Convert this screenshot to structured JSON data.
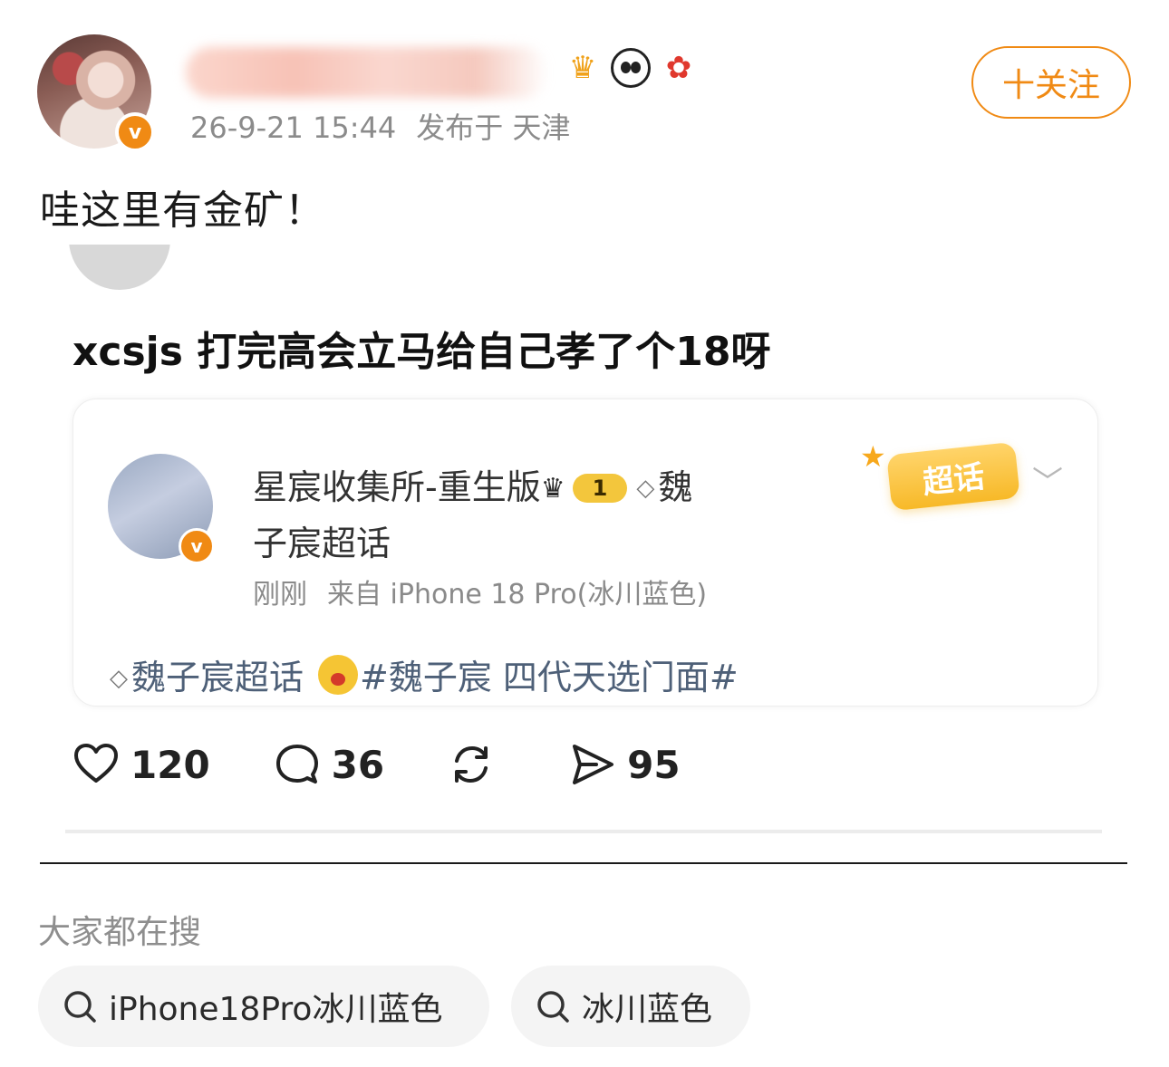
{
  "post": {
    "username": "",
    "timestamp": "26-9-21 15:44",
    "location": "发布于 天津",
    "follow_label": "十关注",
    "verified_mark": "v",
    "badge_icons": [
      "crown-badge-icon",
      "panda-icon",
      "mascot-icon"
    ],
    "text": "哇这里有金矿！"
  },
  "screenshot": {
    "title": "xcsjs 打完高会立马给自己孝了个18呀",
    "card": {
      "author_line1": "星宸收集所-重生版",
      "level": "1",
      "topic_prefix": "魏",
      "author_line2": "子宸超话",
      "time": "刚刚",
      "source": "来自 iPhone 18 Pro(冰川蓝色)",
      "badge_label": "超话",
      "topic_name": "魏子宸超话",
      "hashtag": "#魏子宸 四代天选门面#"
    },
    "actions": {
      "likes": "120",
      "comments": "36",
      "shares": "95"
    }
  },
  "search": {
    "heading": "大家都在搜",
    "chips": [
      "iPhone18Pro冰川蓝色",
      "冰川蓝色"
    ]
  },
  "colors": {
    "accent": "#f08a14",
    "meta_text": "#8b8b8b",
    "chip_bg": "#f4f4f4"
  }
}
